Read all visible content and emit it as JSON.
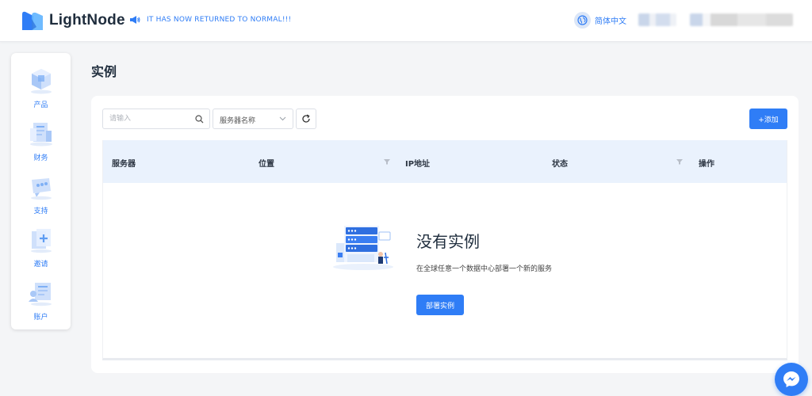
{
  "header": {
    "brand": "LightNode",
    "notice": "IT HAS NOW RETURNED TO NORMAL!!!",
    "language": "简体中文"
  },
  "sidebar": {
    "items": [
      {
        "label": "产品",
        "icon": "product-icon"
      },
      {
        "label": "财务",
        "icon": "finance-icon"
      },
      {
        "label": "支持",
        "icon": "support-icon"
      },
      {
        "label": "邀请",
        "icon": "invite-icon"
      },
      {
        "label": "账户",
        "icon": "account-icon"
      }
    ]
  },
  "main": {
    "title": "实例",
    "search_placeholder": "请输入",
    "select_value": "服务器名称",
    "add_label": "+添加",
    "columns": [
      "服务器",
      "位置",
      "IP地址",
      "状态",
      "操作"
    ],
    "empty": {
      "title": "没有实例",
      "description": "在全球任意一个数据中心部署一个新的服务",
      "button": "部署实例"
    }
  },
  "colors": {
    "accent": "#2f7df6",
    "table_header": "#eaf2fd",
    "background": "#f4f5f7"
  }
}
